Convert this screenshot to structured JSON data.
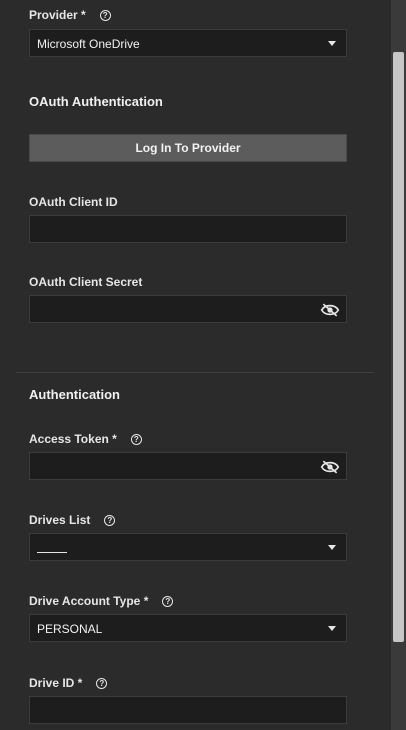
{
  "provider": {
    "label": "Provider *",
    "value": "Microsoft OneDrive"
  },
  "oauth": {
    "title": "OAuth Authentication",
    "login_button": "Log In To Provider",
    "client_id": {
      "label": "OAuth Client ID",
      "value": ""
    },
    "client_secret": {
      "label": "OAuth Client Secret",
      "value": ""
    }
  },
  "authentication": {
    "title": "Authentication",
    "access_token": {
      "label": "Access Token *",
      "value": ""
    },
    "drives_list": {
      "label": "Drives List",
      "value": ""
    },
    "drive_account_type": {
      "label": "Drive Account Type *",
      "value": "PERSONAL"
    },
    "drive_id": {
      "label": "Drive ID *",
      "value": ""
    }
  },
  "icons": {
    "help": "help-circle-icon",
    "visibility": "eye-off-icon",
    "dropdown": "chevron-down-icon"
  }
}
